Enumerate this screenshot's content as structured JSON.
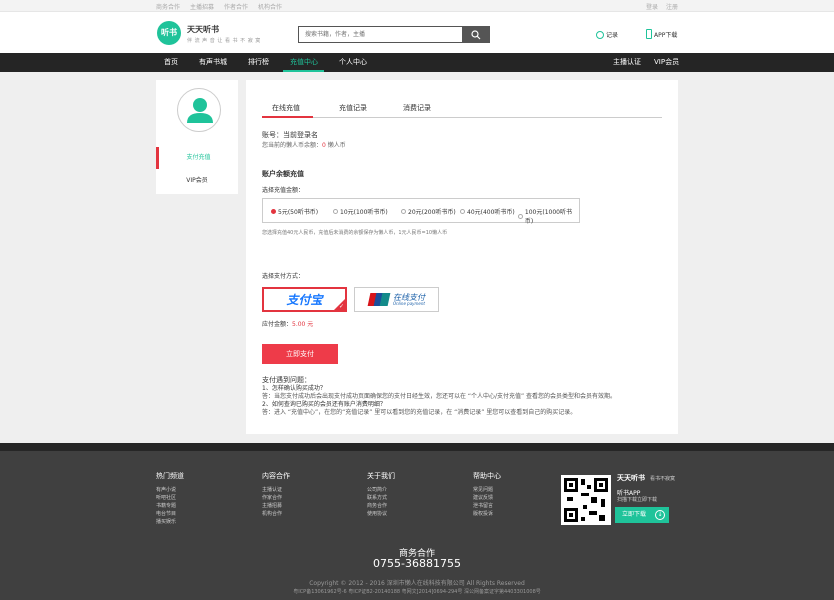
{
  "topbar": {
    "links": [
      "商务合作",
      "主播招募",
      "作者合作",
      "机构合作"
    ],
    "login": "登录",
    "register": "注册"
  },
  "header": {
    "logo_mark": "听书",
    "brand": "天天听书",
    "slogan": "伴 流 声 音   让 看 书 不 寂 寞",
    "search_placeholder": "搜索书籍，作者，主播",
    "history": "记录",
    "app_download": "APP下载"
  },
  "nav": {
    "items": [
      "首页",
      "有声书城",
      "排行榜",
      "充值中心",
      "个人中心"
    ],
    "right": [
      "主播认证",
      "VIP会员"
    ]
  },
  "sidebar": {
    "items": [
      "支付充值",
      "VIP会员"
    ]
  },
  "tabs": [
    "在线充值",
    "充值记录",
    "消费记录"
  ],
  "account": {
    "account_line": "账号：当前登录名",
    "balance_prefix": "您当前的懒人币余额：",
    "balance_value": "0",
    "balance_suffix": " 懒人币"
  },
  "recharge": {
    "section_title": "账户余额充值",
    "choose_amount": "选择充值金额：",
    "options": [
      "5元(50听书币)",
      "10元(100听书币)",
      "20元(200听书币)",
      "40元(400听书币)",
      "100元(1000听书币)"
    ],
    "note": "您选择充值40元人民币，充值后未消费的余额保存为懒人币，1元人民币=10懒人币",
    "choose_payment": "选择支付方式：",
    "alipay": "支付宝",
    "unionpay_cn": "在线支付",
    "unionpay_en": "Online payment",
    "due_label": "应付金额：",
    "due_value": "5.00",
    "due_unit": " 元",
    "pay_button": "立即支付"
  },
  "faq": {
    "title": "支付遇到问题：",
    "lines": [
      "1、怎样确认购买成功？",
      "答：当您支付成功后会出现支付成功页面确保您的支付日经生效，您还可以在 “个人中心/支付充值” 查看您的会员类型和会员有效期。",
      "2、如何查询已购买的会员还有账户消费明细？",
      "答：进入 “充值中心”，在您的“充值记录” 里可以看到您的充值记录，在 “消费记录” 里您可以查看到自己的购买记录。"
    ]
  },
  "footer": {
    "columns": [
      {
        "head": "热门频道",
        "items": [
          "有声小说",
          "听吧社区",
          "书籍专题",
          "电台节目",
          "播买娱乐"
        ]
      },
      {
        "head": "内容合作",
        "items": [
          "主播认证",
          "作家合作",
          "主播招募",
          "机构合作"
        ]
      },
      {
        "head": "关于我们",
        "items": [
          "公司简介",
          "联系方式",
          "商务合作",
          "使用协议"
        ]
      },
      {
        "head": "帮助中心",
        "items": [
          "常见问题",
          "建议反馈",
          "泄书留言",
          "版权投诉"
        ]
      }
    ],
    "brand": "天天听书",
    "brand_sub": "看书不寂寞",
    "app_title": "听书APP",
    "app_sub": "扫描下载立即下载",
    "download": "立即下载",
    "biz_title": "商务合作",
    "biz_phone": "0755-36881755",
    "copyright": "Copyright © 2012 - 2016 深圳市懒人在线科技有限公司 All Rights Reserved",
    "icp": "粤ICP备13061962号-6    粤ICP证B2-20140188    粤网文[2014]0694-294号    深公网备案证字第4403301008号"
  },
  "colors": {
    "accent_green": "#1fc39a",
    "accent_red": "#e3343f",
    "nav_bg": "#252525",
    "footer_bg": "#404040"
  }
}
